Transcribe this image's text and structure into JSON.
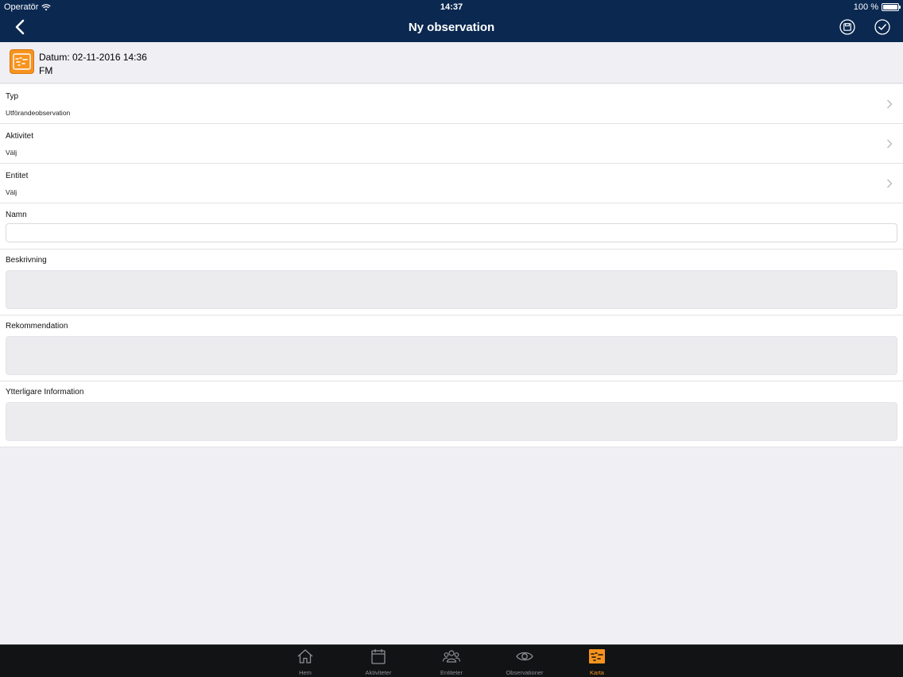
{
  "status_bar": {
    "carrier": "Operatör",
    "time": "14:37",
    "battery": "100 %"
  },
  "nav": {
    "title": "Ny observation",
    "back_icon": "chevron-left-icon",
    "save_icon": "save-icon",
    "done_icon": "checkmark-circle-icon"
  },
  "header": {
    "date_line": "Datum: 02-11-2016 14:36",
    "sub_line": "FM",
    "icon": "map-icon"
  },
  "fields": {
    "typ": {
      "label": "Typ",
      "value": "Utförandeobservation"
    },
    "aktivitet": {
      "label": "Aktivitet",
      "value": "Välj"
    },
    "entitet": {
      "label": "Entitet",
      "value": "Välj"
    },
    "namn": {
      "label": "Namn",
      "value": ""
    },
    "beskrivning": {
      "label": "Beskrivning",
      "value": ""
    },
    "rekommendation": {
      "label": "Rekommendation",
      "value": ""
    },
    "ytterligare": {
      "label": "Ytterligare Information",
      "value": ""
    }
  },
  "tabs": [
    {
      "label": "Hem",
      "icon": "home-icon"
    },
    {
      "label": "Aktiviteter",
      "icon": "calendar-icon"
    },
    {
      "label": "Entiteter",
      "icon": "people-icon"
    },
    {
      "label": "Observationer",
      "icon": "eye-icon"
    },
    {
      "label": "Karta",
      "icon": "map-icon",
      "active": true
    }
  ],
  "colors": {
    "nav_bg": "#0a2850",
    "accent": "#f7931e",
    "tabbar_bg": "#111315"
  }
}
